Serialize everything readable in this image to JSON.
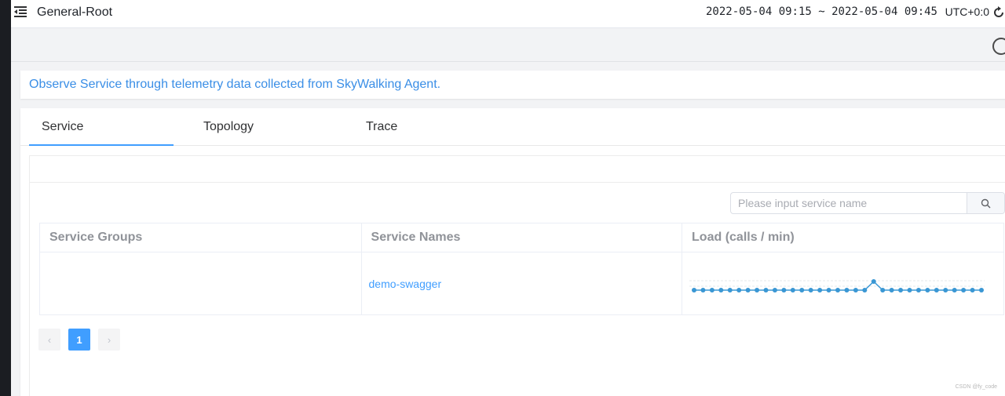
{
  "header": {
    "title": "General-Root",
    "time_range": "2022-05-04 09:15 ~ 2022-05-04 09:45",
    "timezone": "UTC+0:0"
  },
  "description": "Observe Service through telemetry data collected from SkyWalking Agent.",
  "tabs": [
    {
      "label": "Service",
      "active": true
    },
    {
      "label": "Topology",
      "active": false
    },
    {
      "label": "Trace",
      "active": false
    }
  ],
  "search": {
    "placeholder": "Please input service name",
    "value": ""
  },
  "table": {
    "columns": [
      "Service Groups",
      "Service Names",
      "Load (calls / min)"
    ],
    "rows": [
      {
        "group": "",
        "name": "demo-swagger",
        "load_series": [
          0,
          0,
          0,
          0,
          0,
          0,
          0,
          0,
          0,
          0,
          0,
          0,
          0,
          0,
          0,
          0,
          0,
          0,
          0,
          0,
          1,
          0,
          0,
          0,
          0,
          0,
          0,
          0,
          0,
          0,
          0,
          0,
          0
        ]
      }
    ]
  },
  "pagination": {
    "prev": "‹",
    "current": "1",
    "next": "›"
  },
  "colors": {
    "accent": "#409eff",
    "description_text": "#3a8ee6",
    "sparkline": "#3a97d4"
  },
  "icons": [
    "menu-fold-icon",
    "reload-icon",
    "search-icon",
    "spinner-icon"
  ],
  "watermark": "CSDN @fy_code"
}
